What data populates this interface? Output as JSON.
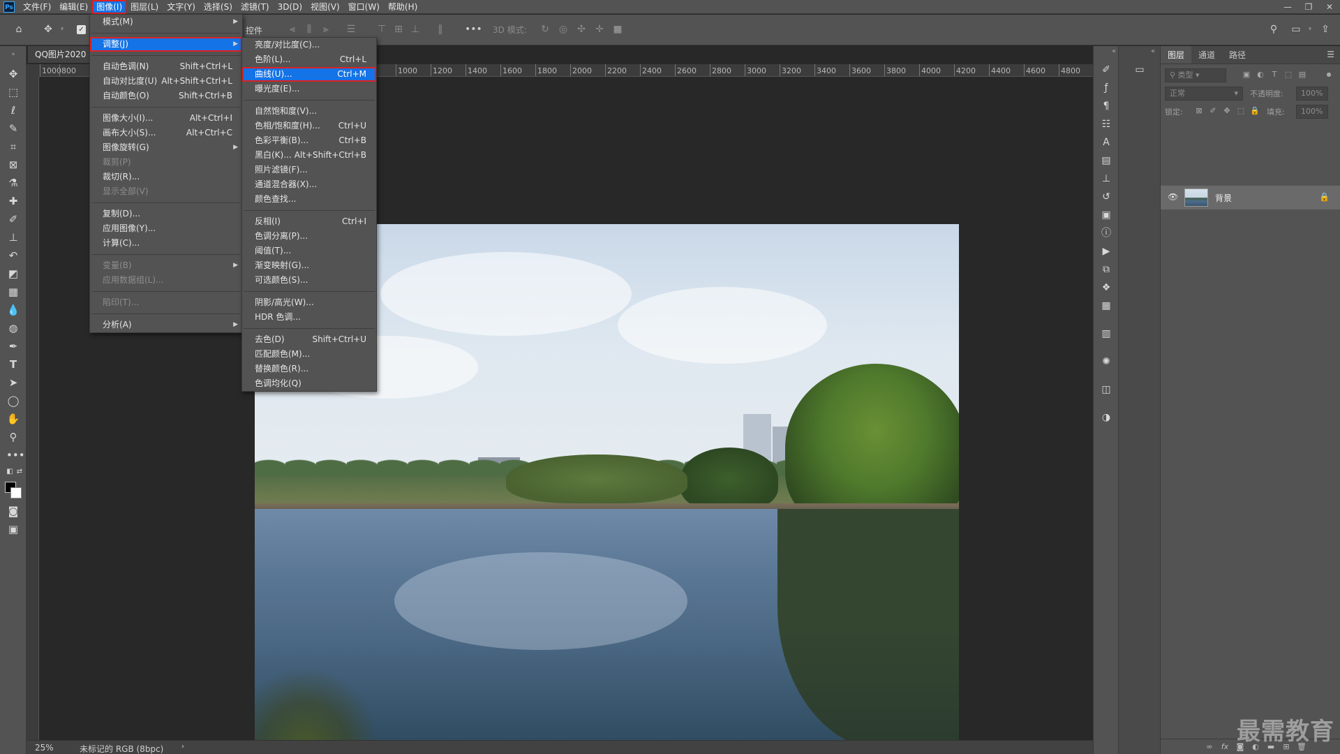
{
  "app": {
    "logo": "Ps"
  },
  "menubar": {
    "items": [
      "文件(F)",
      "编辑(E)",
      "图像(I)",
      "图层(L)",
      "文字(Y)",
      "选择(S)",
      "滤镜(T)",
      "3D(D)",
      "视图(V)",
      "窗口(W)",
      "帮助(H)"
    ],
    "active_index": 2
  },
  "window_controls": {
    "minimize": "—",
    "restore": "❐",
    "close": "✕"
  },
  "options_bar": {
    "control_label": "控件",
    "mode_3d_label": "3D 模式:"
  },
  "document": {
    "tab_title": "QQ图片2020"
  },
  "ruler": {
    "labels": [
      "1000",
      "800",
      "1000",
      "1200",
      "1400",
      "1600",
      "1800",
      "2000",
      "2200",
      "2400",
      "2600",
      "2800",
      "3000",
      "3200",
      "3400",
      "3600",
      "3800",
      "4000",
      "4200",
      "4400",
      "4600",
      "4800"
    ]
  },
  "image_menu": {
    "items": [
      {
        "label": "模式(M)",
        "shortcut": "",
        "submenu": true,
        "disabled": false
      },
      {
        "sep": true
      },
      {
        "label": "调整(J)",
        "shortcut": "",
        "submenu": true,
        "disabled": false,
        "highlight": true
      },
      {
        "sep": true
      },
      {
        "label": "自动色调(N)",
        "shortcut": "Shift+Ctrl+L",
        "submenu": false,
        "disabled": false
      },
      {
        "label": "自动对比度(U)",
        "shortcut": "Alt+Shift+Ctrl+L",
        "submenu": false,
        "disabled": false
      },
      {
        "label": "自动颜色(O)",
        "shortcut": "Shift+Ctrl+B",
        "submenu": false,
        "disabled": false
      },
      {
        "sep": true
      },
      {
        "label": "图像大小(I)...",
        "shortcut": "Alt+Ctrl+I",
        "submenu": false,
        "disabled": false
      },
      {
        "label": "画布大小(S)...",
        "shortcut": "Alt+Ctrl+C",
        "submenu": false,
        "disabled": false
      },
      {
        "label": "图像旋转(G)",
        "shortcut": "",
        "submenu": true,
        "disabled": false
      },
      {
        "label": "裁剪(P)",
        "shortcut": "",
        "submenu": false,
        "disabled": true
      },
      {
        "label": "裁切(R)...",
        "shortcut": "",
        "submenu": false,
        "disabled": false
      },
      {
        "label": "显示全部(V)",
        "shortcut": "",
        "submenu": false,
        "disabled": true
      },
      {
        "sep": true
      },
      {
        "label": "复制(D)...",
        "shortcut": "",
        "submenu": false,
        "disabled": false
      },
      {
        "label": "应用图像(Y)...",
        "shortcut": "",
        "submenu": false,
        "disabled": false
      },
      {
        "label": "计算(C)...",
        "shortcut": "",
        "submenu": false,
        "disabled": false
      },
      {
        "sep": true
      },
      {
        "label": "变量(B)",
        "shortcut": "",
        "submenu": true,
        "disabled": true
      },
      {
        "label": "应用数据组(L)...",
        "shortcut": "",
        "submenu": false,
        "disabled": true
      },
      {
        "sep": true
      },
      {
        "label": "陷印(T)...",
        "shortcut": "",
        "submenu": false,
        "disabled": true
      },
      {
        "sep": true
      },
      {
        "label": "分析(A)",
        "shortcut": "",
        "submenu": true,
        "disabled": false
      }
    ]
  },
  "adjust_menu": {
    "items": [
      {
        "label": "亮度/对比度(C)...",
        "shortcut": ""
      },
      {
        "label": "色阶(L)...",
        "shortcut": "Ctrl+L"
      },
      {
        "label": "曲线(U)...",
        "shortcut": "Ctrl+M",
        "highlight": true
      },
      {
        "label": "曝光度(E)...",
        "shortcut": ""
      },
      {
        "sep": true
      },
      {
        "label": "自然饱和度(V)...",
        "shortcut": ""
      },
      {
        "label": "色相/饱和度(H)...",
        "shortcut": "Ctrl+U"
      },
      {
        "label": "色彩平衡(B)...",
        "shortcut": "Ctrl+B"
      },
      {
        "label": "黑白(K)...",
        "shortcut": "Alt+Shift+Ctrl+B"
      },
      {
        "label": "照片滤镜(F)...",
        "shortcut": ""
      },
      {
        "label": "通道混合器(X)...",
        "shortcut": ""
      },
      {
        "label": "颜色查找...",
        "shortcut": ""
      },
      {
        "sep": true
      },
      {
        "label": "反相(I)",
        "shortcut": "Ctrl+I"
      },
      {
        "label": "色调分离(P)...",
        "shortcut": ""
      },
      {
        "label": "阈值(T)...",
        "shortcut": ""
      },
      {
        "label": "渐变映射(G)...",
        "shortcut": ""
      },
      {
        "label": "可选颜色(S)...",
        "shortcut": ""
      },
      {
        "sep": true
      },
      {
        "label": "阴影/高光(W)...",
        "shortcut": ""
      },
      {
        "label": "HDR 色调...",
        "shortcut": ""
      },
      {
        "sep": true
      },
      {
        "label": "去色(D)",
        "shortcut": "Shift+Ctrl+U"
      },
      {
        "label": "匹配颜色(M)...",
        "shortcut": ""
      },
      {
        "label": "替换颜色(R)...",
        "shortcut": ""
      },
      {
        "label": "色调均化(Q)",
        "shortcut": ""
      }
    ]
  },
  "layers_panel": {
    "tabs": [
      "图层",
      "通道",
      "路径"
    ],
    "active_tab": 0,
    "filter_placeholder": "类型",
    "blend_mode": "正常",
    "opacity_label": "不透明度:",
    "opacity_value": "100%",
    "lock_label": "锁定:",
    "fill_label": "填充:",
    "fill_value": "100%",
    "layer_name": "背景"
  },
  "status": {
    "zoom": "25%",
    "doc_info": "未标记的 RGB (8bpc)"
  },
  "watermark": "最需教育",
  "colors": {
    "accent": "#1473e6",
    "highlight_border": "#e02020",
    "panel_bg": "#535353",
    "canvas_bg": "#282828"
  }
}
